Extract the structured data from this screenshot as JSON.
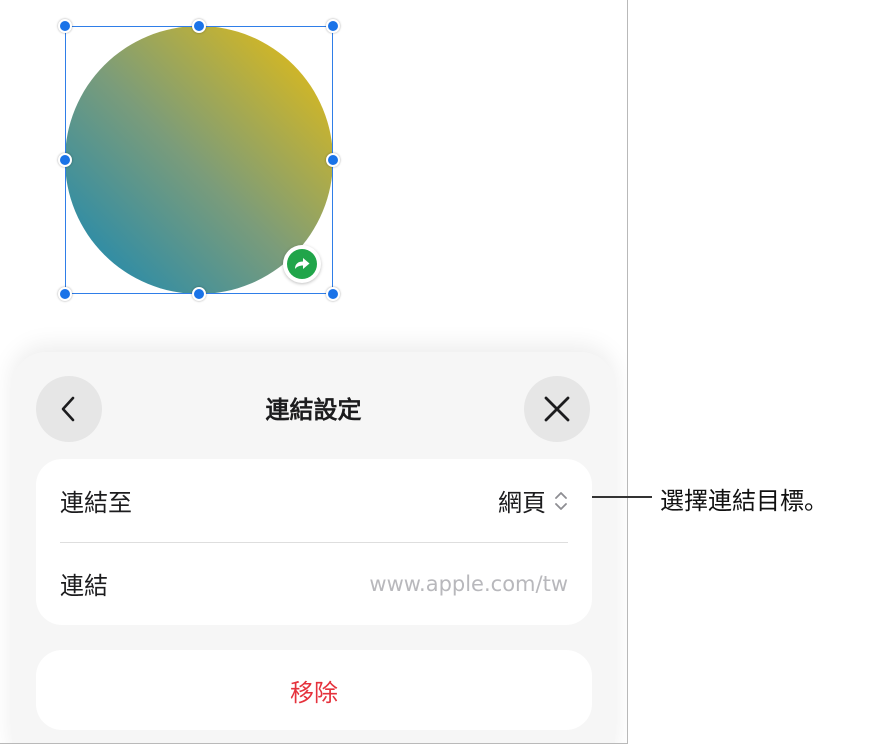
{
  "panel": {
    "title": "連結設定",
    "link_to_label": "連結至",
    "link_to_value": "網頁",
    "link_label": "連結",
    "link_placeholder": "www.apple.com/tw",
    "remove_label": "移除"
  },
  "callout": {
    "text": "選擇連結目標。"
  },
  "colors": {
    "accent": "#1a73e8",
    "remove": "#e5323c",
    "link_badge": "#21a54a",
    "gradient_start": "#1387b6",
    "gradient_end": "#eebf0a"
  }
}
